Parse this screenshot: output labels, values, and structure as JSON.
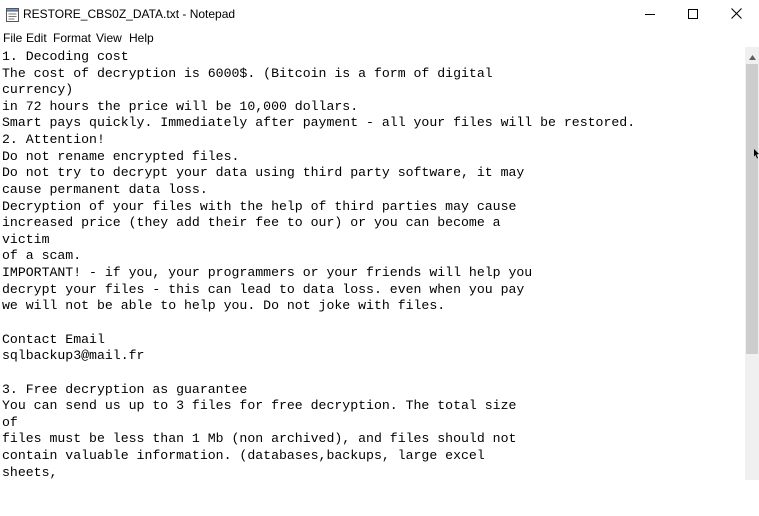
{
  "window": {
    "title": "RESTORE_CBS0Z_DATA.txt - Notepad",
    "icon": "notepad-icon",
    "controls": [
      "minimize-icon",
      "maximize-icon",
      "close-icon"
    ]
  },
  "menu": {
    "items": [
      "File",
      "Edit",
      "Format",
      "View",
      "Help"
    ]
  },
  "document": {
    "lines": [
      "1. Decoding cost",
      "The cost of decryption is 6000$. (Bitcoin is a form of digital",
      "currency)",
      "in 72 hours the price will be 10,000 dollars.",
      "Smart pays quickly. Immediately after payment - all your files will be restored.",
      "2. Attention!",
      "Do not rename encrypted files.",
      "Do not try to decrypt your data using third party software, it may",
      "cause permanent data loss.",
      "Decryption of your files with the help of third parties may cause",
      "increased price (they add their fee to our) or you can become a",
      "victim",
      "of a scam.",
      "IMPORTANT! - if you, your programmers or your friends will help you",
      "decrypt your files - this can lead to data loss. even when you pay",
      "we will not be able to help you. Do not joke with files.",
      "",
      "Contact Email",
      "sqlbackup3@mail.fr",
      "",
      "3. Free decryption as guarantee",
      "You can send us up to 3 files for free decryption. The total size",
      "of",
      "files must be less than 1 Mb (non archived), and files should not",
      "contain valuable information. (databases,backups, large excel",
      "sheets,"
    ]
  },
  "colors": {
    "background": "#ffffff",
    "scrollbar_track": "#f0f0f0",
    "scrollbar_thumb": "#cdcdcd",
    "text": "#000000"
  }
}
